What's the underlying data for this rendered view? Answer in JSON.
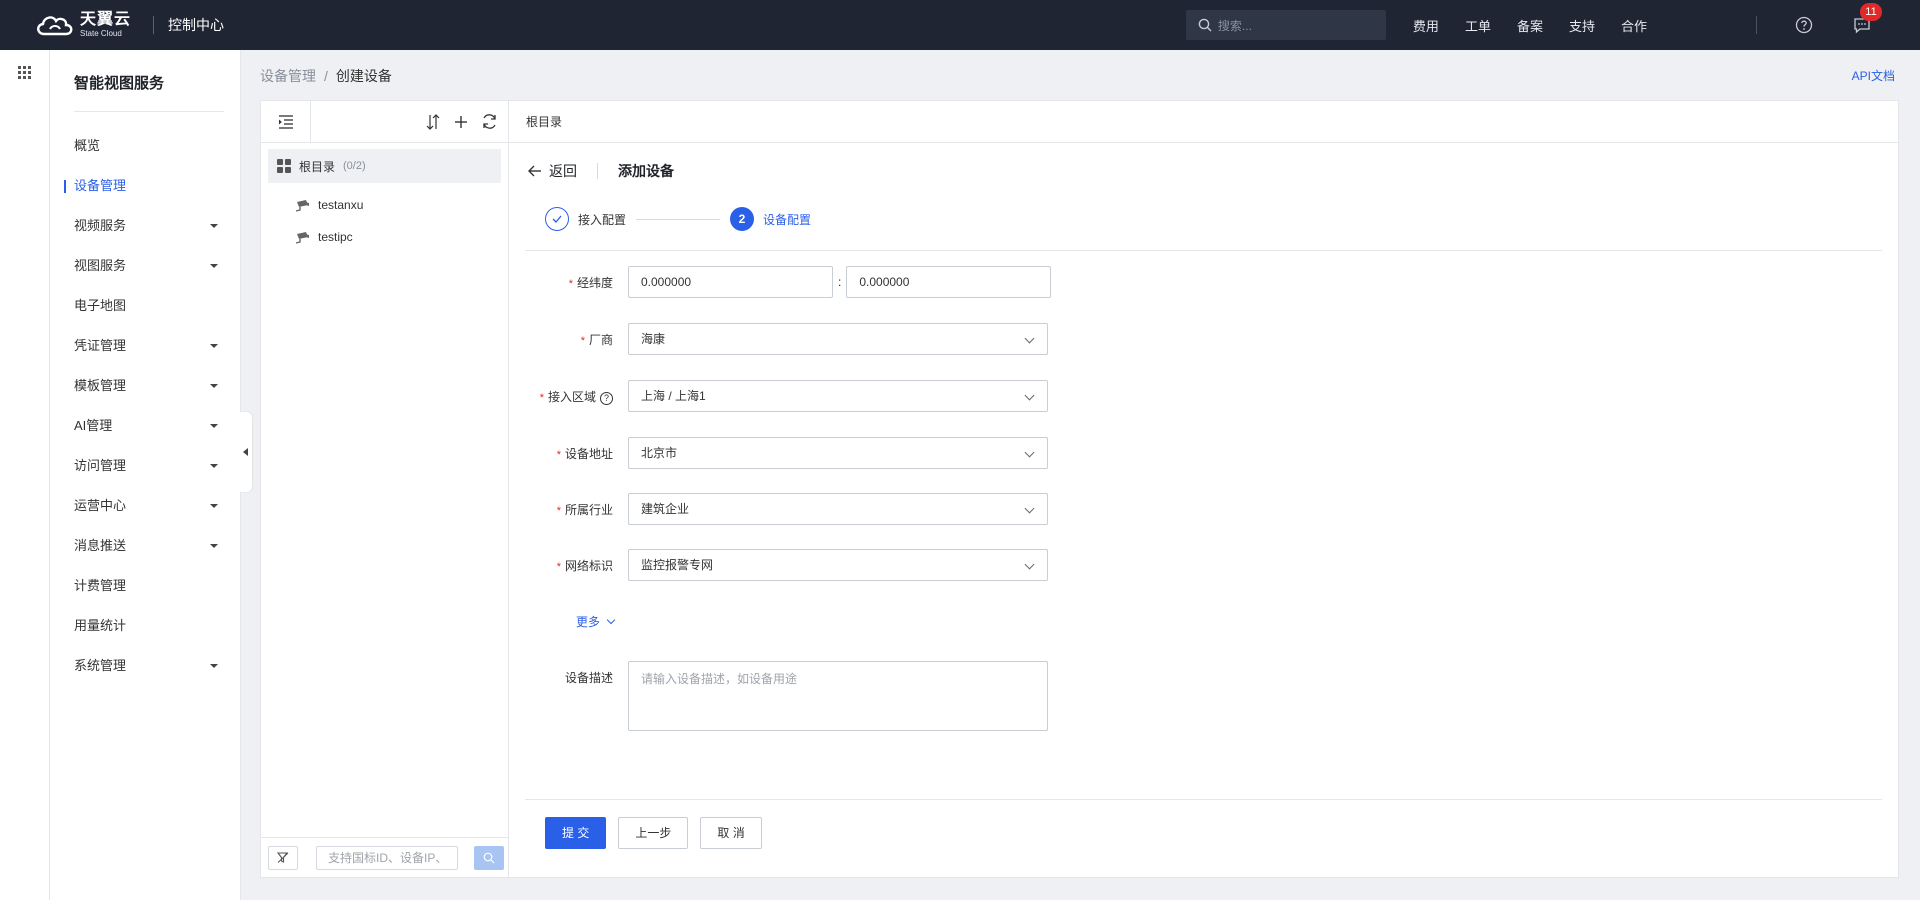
{
  "topbar": {
    "logo_cn": "天翼云",
    "logo_en": "State Cloud",
    "console": "控制中心",
    "search_placeholder": "搜索...",
    "links": [
      "费用",
      "工单",
      "备案",
      "支持",
      "合作"
    ],
    "badge_count": "11"
  },
  "sidebar": {
    "title": "智能视图服务",
    "items": [
      {
        "label": "概览",
        "caret": false,
        "active": false
      },
      {
        "label": "设备管理",
        "caret": false,
        "active": true
      },
      {
        "label": "视频服务",
        "caret": true,
        "active": false
      },
      {
        "label": "视图服务",
        "caret": true,
        "active": false
      },
      {
        "label": "电子地图",
        "caret": false,
        "active": false
      },
      {
        "label": "凭证管理",
        "caret": true,
        "active": false
      },
      {
        "label": "模板管理",
        "caret": true,
        "active": false
      },
      {
        "label": "AI管理",
        "caret": true,
        "active": false
      },
      {
        "label": "访问管理",
        "caret": true,
        "active": false
      },
      {
        "label": "运营中心",
        "caret": true,
        "active": false
      },
      {
        "label": "消息推送",
        "caret": true,
        "active": false
      },
      {
        "label": "计费管理",
        "caret": false,
        "active": false
      },
      {
        "label": "用量统计",
        "caret": false,
        "active": false
      },
      {
        "label": "系统管理",
        "caret": true,
        "active": false
      }
    ]
  },
  "breadcrumb": {
    "parent": "设备管理",
    "separator": "/",
    "current": "创建设备"
  },
  "api_doc": "API文档",
  "tree": {
    "root_label": "根目录",
    "root_count": "(0/2)",
    "nodes": [
      "testanxu",
      "testipc"
    ],
    "search_placeholder": "支持国标ID、设备IP、"
  },
  "main": {
    "header": "根目录",
    "back": "返回",
    "title": "添加设备",
    "steps": [
      {
        "label": "接入配置",
        "state": "done"
      },
      {
        "label": "设备配置",
        "state": "current",
        "number": "2"
      }
    ],
    "form": {
      "latlng_label": "经纬度",
      "latitude": "0.000000",
      "longitude": "0.000000",
      "vendor_label": "厂商",
      "vendor": "海康",
      "region_label": "接入区域",
      "region": "上海 / 上海1",
      "address_label": "设备地址",
      "address": "北京市",
      "industry_label": "所属行业",
      "industry": "建筑企业",
      "network_label": "网络标识",
      "network": "监控报警专网",
      "more": "更多",
      "desc_label": "设备描述",
      "desc_placeholder": "请输入设备描述，如设备用途"
    },
    "buttons": {
      "submit": "提 交",
      "prev": "上一步",
      "cancel": "取 消"
    }
  },
  "colors": {
    "accent": "#2a5fe8",
    "topbar": "#1f2533",
    "badge": "#e02a2a",
    "required": "#e02a2a"
  }
}
